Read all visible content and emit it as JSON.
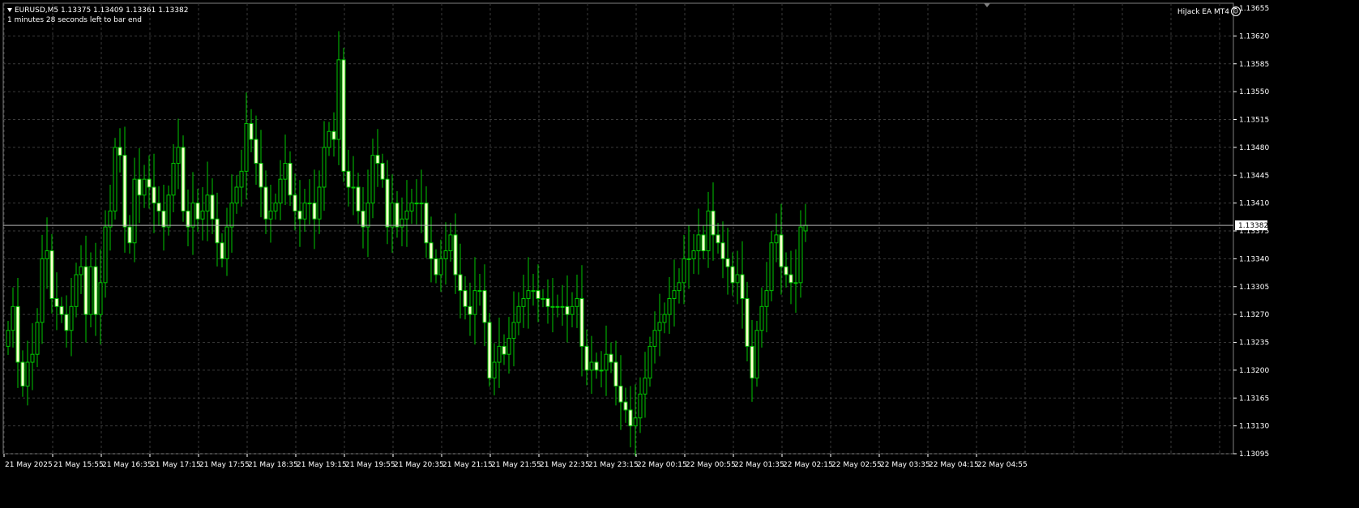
{
  "chart": {
    "symbol_line": "EURUSD,M5  1.13375 1.13409 1.13361 1.13382",
    "countdown": "1 minutes 28 seconds left to bar end",
    "ea_label": "HiJack EA MT4",
    "current_price": "1.13382",
    "colors": {
      "background": "#000000",
      "grid": "#3a3a3a",
      "candle": "#00c800",
      "bull_body": "#000000",
      "bear_body": "#ffffd0",
      "current_line": "#b0b0b0"
    }
  },
  "chart_data": {
    "type": "candlestick",
    "ylim": [
      1.13095,
      1.13655
    ],
    "y_ticks": [
      "1.13655",
      "1.13620",
      "1.13585",
      "1.13550",
      "1.13515",
      "1.13480",
      "1.13445",
      "1.13410",
      "1.13375",
      "1.13340",
      "1.13305",
      "1.13270",
      "1.13235",
      "1.13200",
      "1.13165",
      "1.13130",
      "1.13095"
    ],
    "x_ticks": [
      "21 May 2025",
      "21 May 15:55",
      "21 May 16:35",
      "21 May 17:15",
      "21 May 17:55",
      "21 May 18:35",
      "21 May 19:15",
      "21 May 19:55",
      "21 May 20:35",
      "21 May 21:15",
      "21 May 21:55",
      "21 May 22:35",
      "21 May 23:15",
      "22 May 00:15",
      "22 May 00:55",
      "22 May 01:35",
      "22 May 02:15",
      "22 May 02:55",
      "22 May 03:35",
      "22 May 04:15",
      "22 May 04:55"
    ],
    "close": [
      1.1325,
      1.1328,
      1.1321,
      1.1318,
      1.1321,
      1.1322,
      1.1326,
      1.1334,
      1.1335,
      1.1329,
      1.1328,
      1.1327,
      1.1325,
      1.1328,
      1.1332,
      1.1333,
      1.1327,
      1.1333,
      1.1327,
      1.1331,
      1.1338,
      1.134,
      1.1348,
      1.1347,
      1.1338,
      1.1336,
      1.1344,
      1.1342,
      1.1344,
      1.1343,
      1.1341,
      1.134,
      1.1338,
      1.1342,
      1.1346,
      1.1348,
      1.134,
      1.1338,
      1.1341,
      1.1339,
      1.134,
      1.1342,
      1.1339,
      1.1336,
      1.1334,
      1.1338,
      1.1341,
      1.1343,
      1.1345,
      1.1351,
      1.1349,
      1.1346,
      1.1343,
      1.1339,
      1.134,
      1.1341,
      1.1344,
      1.1346,
      1.1342,
      1.134,
      1.1339,
      1.1341,
      1.1341,
      1.1339,
      1.1343,
      1.1348,
      1.135,
      1.1349,
      1.1359,
      1.1345,
      1.1343,
      1.1343,
      1.134,
      1.1338,
      1.1341,
      1.1347,
      1.1346,
      1.1344,
      1.1338,
      1.1341,
      1.1338,
      1.1339,
      1.134,
      1.1341,
      1.1341,
      1.1341,
      1.1336,
      1.1334,
      1.1332,
      1.1334,
      1.1335,
      1.1337,
      1.1332,
      1.133,
      1.1328,
      1.1327,
      1.133,
      1.133,
      1.1326,
      1.1319,
      1.1321,
      1.1323,
      1.1322,
      1.1324,
      1.1326,
      1.1328,
      1.1329,
      1.133,
      1.133,
      1.1329,
      1.1329,
      1.1328,
      1.1328,
      1.1328,
      1.1328,
      1.1327,
      1.1328,
      1.1329,
      1.1323,
      1.132,
      1.1321,
      1.132,
      1.132,
      1.1322,
      1.1321,
      1.1318,
      1.1316,
      1.1315,
      1.1313,
      1.1314,
      1.1317,
      1.1319,
      1.1323,
      1.1325,
      1.1326,
      1.1327,
      1.1329,
      1.133,
      1.1331,
      1.1334,
      1.1334,
      1.1335,
      1.1337,
      1.1335,
      1.134,
      1.1337,
      1.1336,
      1.1334,
      1.1333,
      1.1331,
      1.1332,
      1.1329,
      1.1323,
      1.1319,
      1.1325,
      1.1328,
      1.133,
      1.1336,
      1.1337,
      1.1333,
      1.1332,
      1.1331,
      1.1331,
      1.1338
    ],
    "last": {
      "open": 1.13375,
      "high": 1.13409,
      "low": 1.13361,
      "close": 1.13382
    }
  }
}
